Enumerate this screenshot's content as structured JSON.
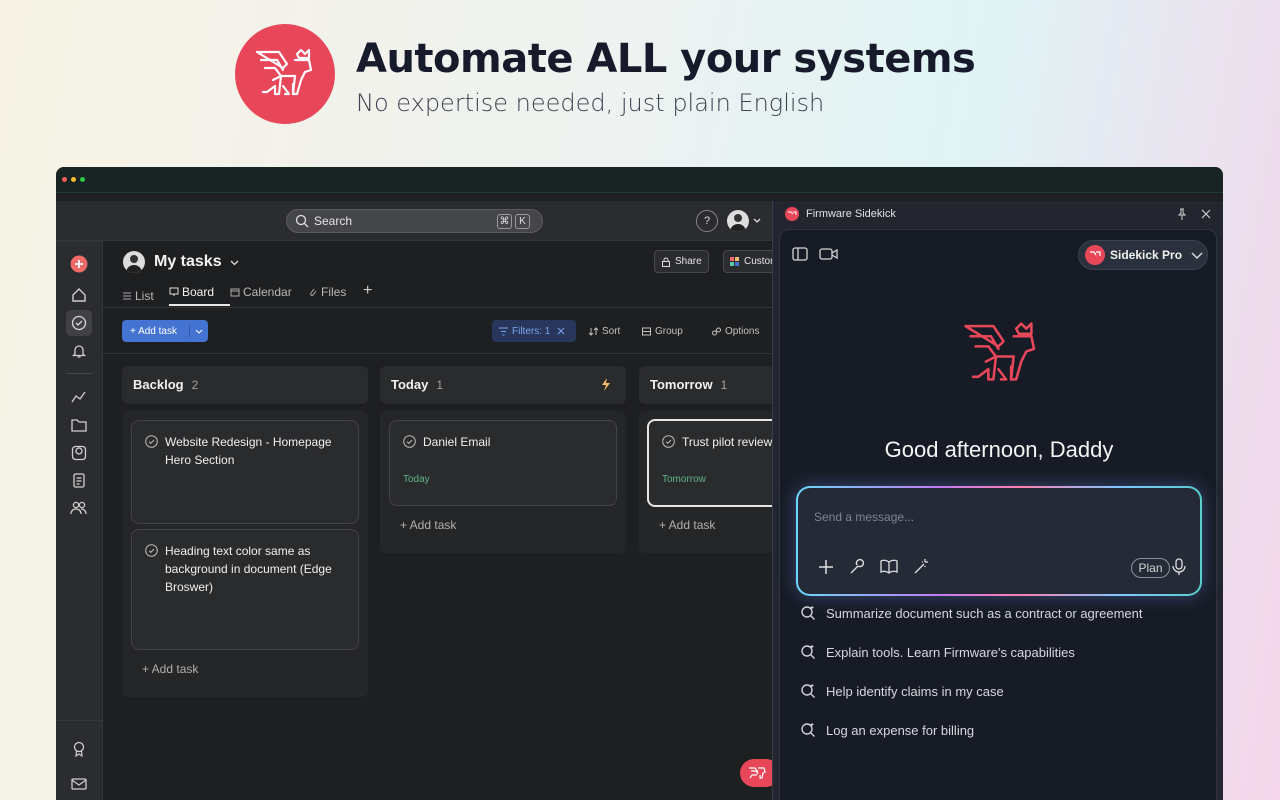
{
  "hero": {
    "title": "Automate ALL your systems",
    "subtitle": "No expertise needed, just plain English",
    "accent": "#e8475a"
  },
  "topbar": {
    "search_label": "Search",
    "shortcut_keys": [
      "⌘",
      "K"
    ],
    "help_label": "?"
  },
  "page": {
    "title": "My tasks",
    "share_label": "Share",
    "customize_label": "Custom",
    "tabs": [
      {
        "label": "List",
        "icon": "list-icon"
      },
      {
        "label": "Board",
        "icon": "board-icon",
        "active": true
      },
      {
        "label": "Calendar",
        "icon": "calendar-icon"
      },
      {
        "label": "Files",
        "icon": "paperclip-icon"
      }
    ]
  },
  "toolbar": {
    "add_task_label": "Add task",
    "filters_label": "Filters: 1",
    "sort_label": "Sort",
    "group_label": "Group",
    "options_label": "Options"
  },
  "board": {
    "add_task_label": "+ Add task",
    "columns": [
      {
        "name": "Backlog",
        "count": "2",
        "cards": [
          {
            "title": "Website Redesign - Homepage Hero Section"
          },
          {
            "title": "Heading text color same as background in document (Edge Broswer)"
          }
        ]
      },
      {
        "name": "Today",
        "count": "1",
        "cards": [
          {
            "title": "Daniel Email",
            "due": "Today"
          }
        ]
      },
      {
        "name": "Tomorrow",
        "count": "1",
        "cards": [
          {
            "title": "Trust pilot review",
            "due": "Tomorrow"
          }
        ]
      }
    ]
  },
  "sidekick": {
    "window_title": "Firmware Sidekick",
    "plan_name": "Sidekick Pro",
    "greeting": "Good afternoon, Daddy",
    "composer_placeholder": "Send a message...",
    "plan_button": "Plan",
    "suggestions": [
      "Summarize document such as a contract or agreement",
      "Explain tools. Learn Firmware's capabilities",
      "Help identify claims in my case",
      "Log an expense for billing"
    ]
  },
  "colors": {
    "brand_red": "#e8475a",
    "primary_blue": "#4573d2",
    "due_green": "#5fb58a"
  }
}
